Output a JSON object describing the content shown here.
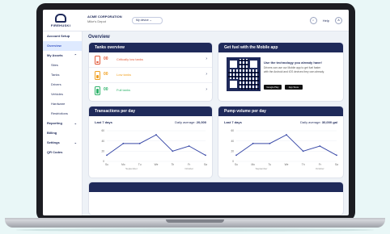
{
  "header": {
    "logo_text": "FIREHUSKI",
    "company_name": "ACME CORPORATION",
    "company_sub": "Mike's Depot",
    "selector_label": "My device",
    "help_label": "?",
    "language": "Help",
    "avatar_label": "A"
  },
  "sidebar": {
    "items": [
      {
        "label": "Account Setup",
        "level": "top"
      },
      {
        "label": "Overview",
        "level": "top",
        "active": true
      },
      {
        "label": "My Assets",
        "level": "top",
        "chev": "⌃"
      },
      {
        "label": "Sites",
        "level": "sub"
      },
      {
        "label": "Tanks",
        "level": "sub"
      },
      {
        "label": "Drivers",
        "level": "sub"
      },
      {
        "label": "Vehicles",
        "level": "sub"
      },
      {
        "label": "Hardware",
        "level": "sub"
      },
      {
        "label": "Restrictions",
        "level": "sub"
      },
      {
        "label": "Reporting",
        "level": "top",
        "chev": "⌄"
      },
      {
        "label": "Billing",
        "level": "top"
      },
      {
        "label": "Settings",
        "level": "top",
        "chev": "⌄"
      },
      {
        "label": "QR Codes",
        "level": "top"
      }
    ]
  },
  "page": {
    "title": "Overview"
  },
  "tanks": {
    "title": "Tanks overview",
    "rows": [
      {
        "count": "00",
        "label": "Critically low tanks",
        "color": "#e25b3a"
      },
      {
        "count": "00",
        "label": "Low tanks",
        "color": "#f0a020"
      },
      {
        "count": "00",
        "label": "Full tanks",
        "color": "#2fb36b"
      }
    ],
    "arrow": "›"
  },
  "mobile_app": {
    "title": "Get fuel with the Mobile app",
    "headline": "Use the technology you already have!",
    "description": "Drivers can use our Mobile app to get fuel faster with the Android and iOS devices they own already.",
    "store_android": "Google Play",
    "store_ios": "App Store"
  },
  "transactions": {
    "title": "Transactions per day",
    "period": "Last 7 days",
    "avg_label": "Daily average:",
    "avg_value": "20,000"
  },
  "pump": {
    "title": "Pump volume per day",
    "period": "Last 7 days",
    "avg_label": "Daily average:",
    "avg_value": "30,000 gal"
  },
  "chart_data": [
    {
      "type": "line",
      "x": [
        "Su",
        "Mo",
        "Tu",
        "We",
        "Th",
        "Fr",
        "Sa"
      ],
      "values": [
        12,
        35,
        35,
        52,
        20,
        30,
        12
      ],
      "ylim": [
        0,
        60
      ],
      "yticks": [
        "60",
        "40",
        "20",
        "0"
      ],
      "xlabel_left": "September",
      "xlabel_right": "October",
      "color": "#3a4aa8"
    },
    {
      "type": "line",
      "x": [
        "Su",
        "Mo",
        "Tu",
        "We",
        "Th",
        "Fr",
        "Sa"
      ],
      "values": [
        12,
        35,
        35,
        52,
        20,
        30,
        12
      ],
      "ylim": [
        0,
        60
      ],
      "yticks": [
        "60",
        "40",
        "20",
        "0"
      ],
      "xlabel_left": "September",
      "xlabel_right": "October",
      "color": "#3a4aa8"
    }
  ]
}
